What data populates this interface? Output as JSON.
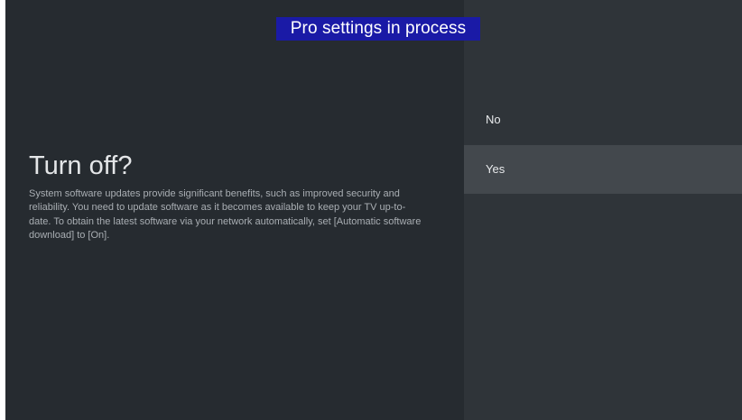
{
  "banner": {
    "text": "Pro settings in process"
  },
  "dialog": {
    "title": "Turn off?",
    "description": "System software updates provide significant benefits, such as improved security and reliability. You need to update software as it becomes available to keep your TV up-to-date. To obtain the latest software via your network automatically, set [Automatic software download] to [On]."
  },
  "options": [
    {
      "label": "No",
      "focused": false
    },
    {
      "label": "Yes",
      "focused": true
    }
  ],
  "colors": {
    "background": "#262b30",
    "options_panel": "#2f3439",
    "focused_option": "#43484d",
    "banner": "#1a1aa6"
  }
}
